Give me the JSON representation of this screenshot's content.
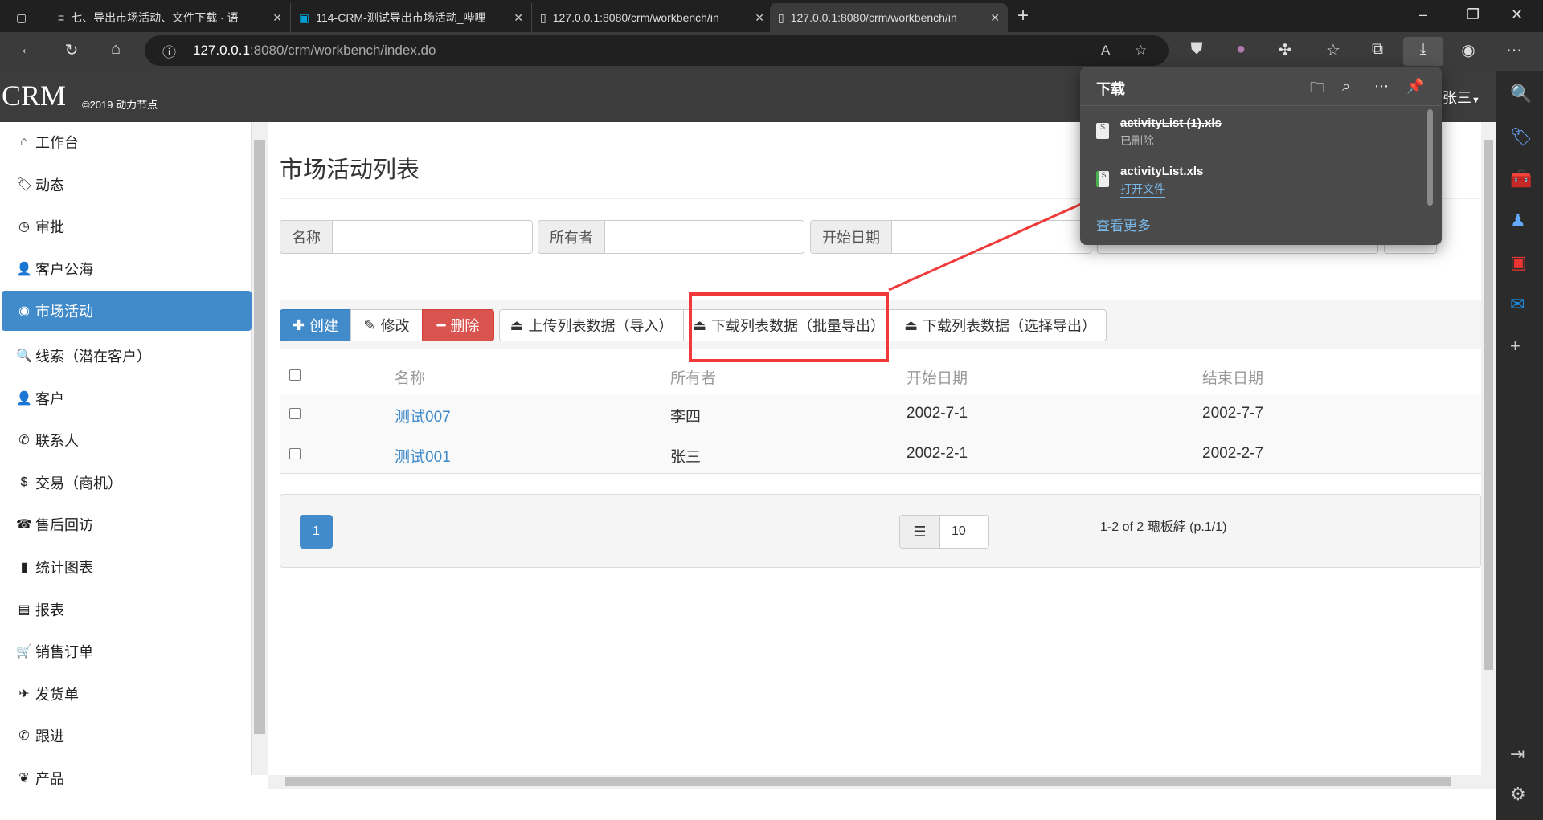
{
  "browser": {
    "tabs": [
      {
        "title": "七、导出市场活动、文件下载 · 语",
        "active": false
      },
      {
        "title": "114-CRM-测试导出市场活动_哔哩",
        "active": false
      },
      {
        "title": "127.0.0.1:8080/crm/workbench/in",
        "active": false
      },
      {
        "title": "127.0.0.1:8080/crm/workbench/in",
        "active": true
      }
    ],
    "url_host": "127.0.0.1",
    "url_rest": ":8080/crm/workbench/index.do"
  },
  "app": {
    "logo": "CRM",
    "copyright": "©2019 动力节点",
    "user": "张三"
  },
  "sidebar": {
    "items": [
      {
        "label": "工作台",
        "icon": "⌂"
      },
      {
        "label": "动态",
        "icon": "🏷"
      },
      {
        "label": "审批",
        "icon": "◷"
      },
      {
        "label": "客户公海",
        "icon": "👤"
      },
      {
        "label": "市场活动",
        "icon": "◉",
        "active": true
      },
      {
        "label": "线索（潜在客户）",
        "icon": "🔍"
      },
      {
        "label": "客户",
        "icon": "👤"
      },
      {
        "label": "联系人",
        "icon": "✆"
      },
      {
        "label": "交易（商机）",
        "icon": "$"
      },
      {
        "label": "售后回访",
        "icon": "☎"
      },
      {
        "label": "统计图表",
        "icon": "▮"
      },
      {
        "label": "报表",
        "icon": "▤"
      },
      {
        "label": "销售订单",
        "icon": "🛒"
      },
      {
        "label": "发货单",
        "icon": "✈"
      },
      {
        "label": "跟进",
        "icon": "✆"
      },
      {
        "label": "产品",
        "icon": "❦"
      }
    ]
  },
  "main": {
    "title": "市场活动列表",
    "filters": [
      {
        "label": "名称",
        "value": ""
      },
      {
        "label": "所有者",
        "value": ""
      },
      {
        "label": "开始日期",
        "value": ""
      }
    ],
    "toolbar": {
      "create": "创建",
      "edit": "修改",
      "delete": "删除",
      "upload": "上传列表数据（导入）",
      "export_all": "下载列表数据（批量导出）",
      "export_selected": "下载列表数据（选择导出）"
    },
    "table": {
      "headers": [
        "名称",
        "所有者",
        "开始日期",
        "结束日期"
      ],
      "rows": [
        {
          "name": "测试007",
          "owner": "李四",
          "start": "2002-7-1",
          "end": "2002-7-7"
        },
        {
          "name": "测试001",
          "owner": "张三",
          "start": "2002-2-1",
          "end": "2002-2-7"
        }
      ]
    },
    "pagination": {
      "current": "1",
      "page_size": "10",
      "info": "1-2 of 2 璁板綍 (p.1/1)"
    }
  },
  "downloads": {
    "title": "下载",
    "items": [
      {
        "name": "activityList (1).xls",
        "status": "已删除"
      },
      {
        "name": "activityList.xls",
        "action": "打开文件"
      }
    ],
    "more": "查看更多"
  }
}
